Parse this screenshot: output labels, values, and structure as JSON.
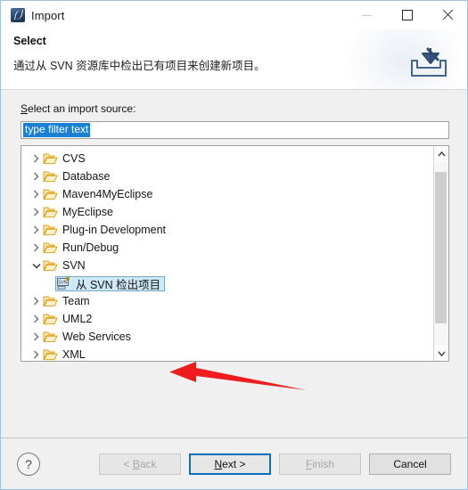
{
  "window": {
    "title": "Import",
    "app_icon": "myeclipse-icon",
    "border_color": "#9dc3e0",
    "controls": [
      {
        "name": "minimize",
        "glyph": "minimize-icon",
        "disabled": true
      },
      {
        "name": "maximize",
        "glyph": "maximize-icon",
        "disabled": false
      },
      {
        "name": "close",
        "glyph": "close-icon",
        "disabled": false
      }
    ]
  },
  "header": {
    "title": "Select",
    "description": "通过从 SVN 资源库中检出已有项目来创建新项目。",
    "icon": "import-tray-icon"
  },
  "main": {
    "source_label_prefix": "S",
    "source_label_rest": "elect an import source:",
    "filter": {
      "value": "type filter text",
      "placeholder": "type filter text",
      "selected": true,
      "selection_color": "#1b7fd4"
    },
    "tree": [
      {
        "label": "CVS",
        "icon": "folder-icon",
        "expanded": false,
        "level": 0,
        "selected": false
      },
      {
        "label": "Database",
        "icon": "folder-icon",
        "expanded": false,
        "level": 0,
        "selected": false
      },
      {
        "label": "Maven4MyEclipse",
        "icon": "folder-icon",
        "expanded": false,
        "level": 0,
        "selected": false
      },
      {
        "label": "MyEclipse",
        "icon": "folder-icon",
        "expanded": false,
        "level": 0,
        "selected": false
      },
      {
        "label": "Plug-in Development",
        "icon": "folder-icon",
        "expanded": false,
        "level": 0,
        "selected": false
      },
      {
        "label": "Run/Debug",
        "icon": "folder-icon",
        "expanded": false,
        "level": 0,
        "selected": false
      },
      {
        "label": "SVN",
        "icon": "folder-icon",
        "expanded": true,
        "level": 0,
        "selected": false
      },
      {
        "label": "从 SVN 检出项目",
        "icon": "svn-checkout-icon",
        "expanded": null,
        "level": 1,
        "selected": true
      },
      {
        "label": "Team",
        "icon": "folder-icon",
        "expanded": false,
        "level": 0,
        "selected": false
      },
      {
        "label": "UML2",
        "icon": "folder-icon",
        "expanded": false,
        "level": 0,
        "selected": false
      },
      {
        "label": "Web Services",
        "icon": "folder-icon",
        "expanded": false,
        "level": 0,
        "selected": false
      },
      {
        "label": "XML",
        "icon": "folder-icon",
        "expanded": false,
        "level": 0,
        "selected": false
      }
    ],
    "scrollbar": {
      "up_icon": "chevron-up-icon",
      "down_icon": "chevron-down-icon"
    },
    "annotation": {
      "type": "red-arrow",
      "color": "#ee1c1c",
      "points_to": "从 SVN 检出项目"
    }
  },
  "footer": {
    "help_label": "?",
    "buttons": [
      {
        "name": "back",
        "label_prefix": "< ",
        "label_key": "B",
        "label_suffix": "ack",
        "full": "< Back",
        "disabled": true,
        "focused": false
      },
      {
        "name": "next",
        "label_prefix": "",
        "label_key": "N",
        "label_suffix": "ext >",
        "full": "Next >",
        "disabled": false,
        "focused": true
      },
      {
        "name": "finish",
        "label_prefix": "",
        "label_key": "F",
        "label_suffix": "inish",
        "full": "Finish",
        "disabled": true,
        "focused": false
      },
      {
        "name": "cancel",
        "label_prefix": "",
        "label_key": "",
        "label_suffix": "Cancel",
        "full": "Cancel",
        "disabled": false,
        "focused": false
      }
    ]
  }
}
